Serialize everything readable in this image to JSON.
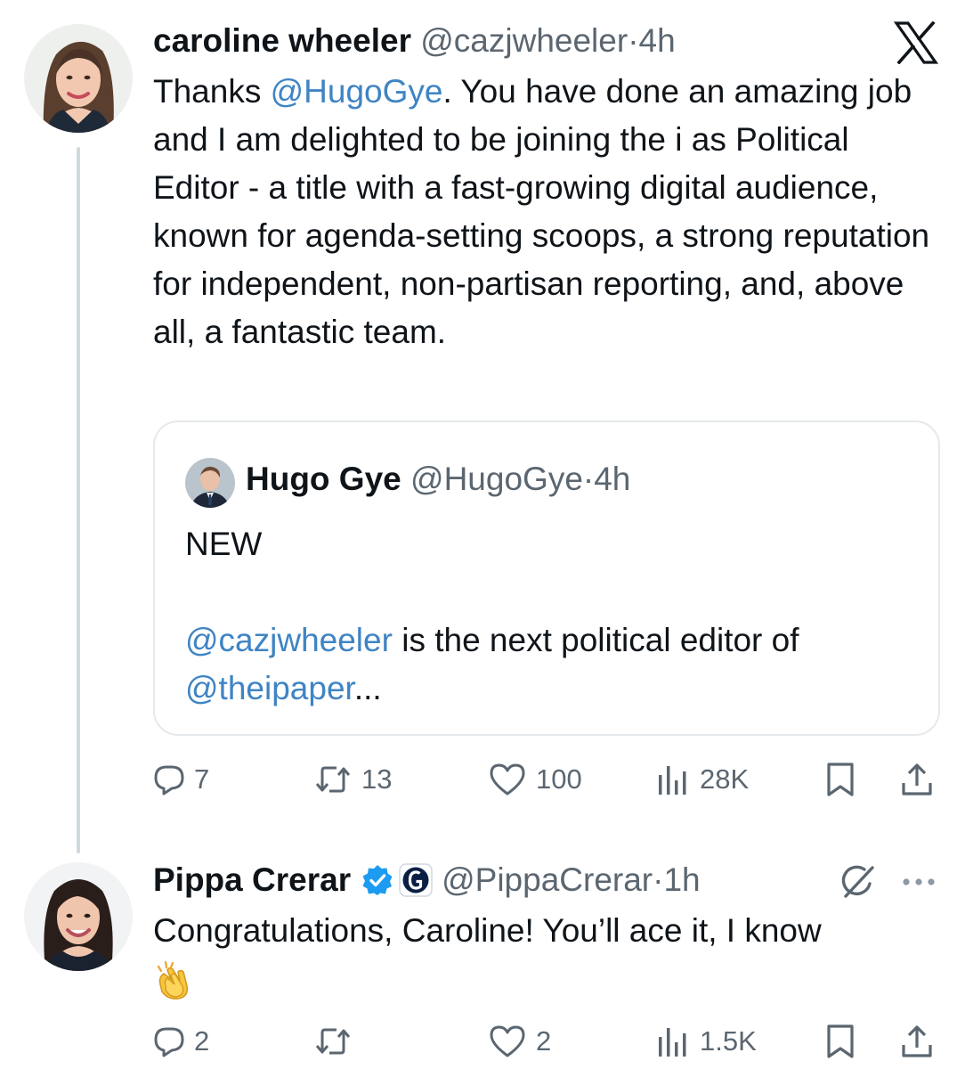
{
  "tweet1": {
    "name": "caroline wheeler",
    "handle": "@cazjwheeler",
    "time": "4h",
    "body_pre": "Thanks ",
    "body_mention": "@HugoGye",
    "body_post": ". You have done an amazing job and I am delighted to be joining the i as Political Editor - a title with a fast-growing digital audience, known for agenda-setting scoops, a strong reputation for independent, non-partisan reporting, and, above all, a fantastic team.",
    "quote": {
      "name": "Hugo Gye",
      "handle": "@HugoGye",
      "time": "4h",
      "line1": "NEW",
      "mention1": "@cazjwheeler",
      "line2_text": " is the next political editor of",
      "mention2": "@theipaper",
      "ellipsis": "..."
    },
    "actions": {
      "replies": "7",
      "reposts": "13",
      "likes": "100",
      "views": "28K"
    }
  },
  "tweet2": {
    "name": "Pippa Crerar",
    "handle": "@PippaCrerar",
    "time": "1h",
    "body": "Congratulations, Caroline! You’ll ace it, I know",
    "emoji": "clapping-hands",
    "actions": {
      "replies": "2",
      "reposts": "",
      "likes": "2",
      "views": "1.5K"
    }
  },
  "separator": "·",
  "colors": {
    "link": "#3f84c4",
    "muted": "#5b6670",
    "verified": "#1d9bf0",
    "thread_line": "#cfd9de"
  },
  "icons": [
    "x-logo-icon",
    "reply-icon",
    "repost-icon",
    "like-icon",
    "views-icon",
    "bookmark-icon",
    "share-icon",
    "verified-icon",
    "guardian-badge-icon",
    "grok-icon",
    "more-icon"
  ]
}
